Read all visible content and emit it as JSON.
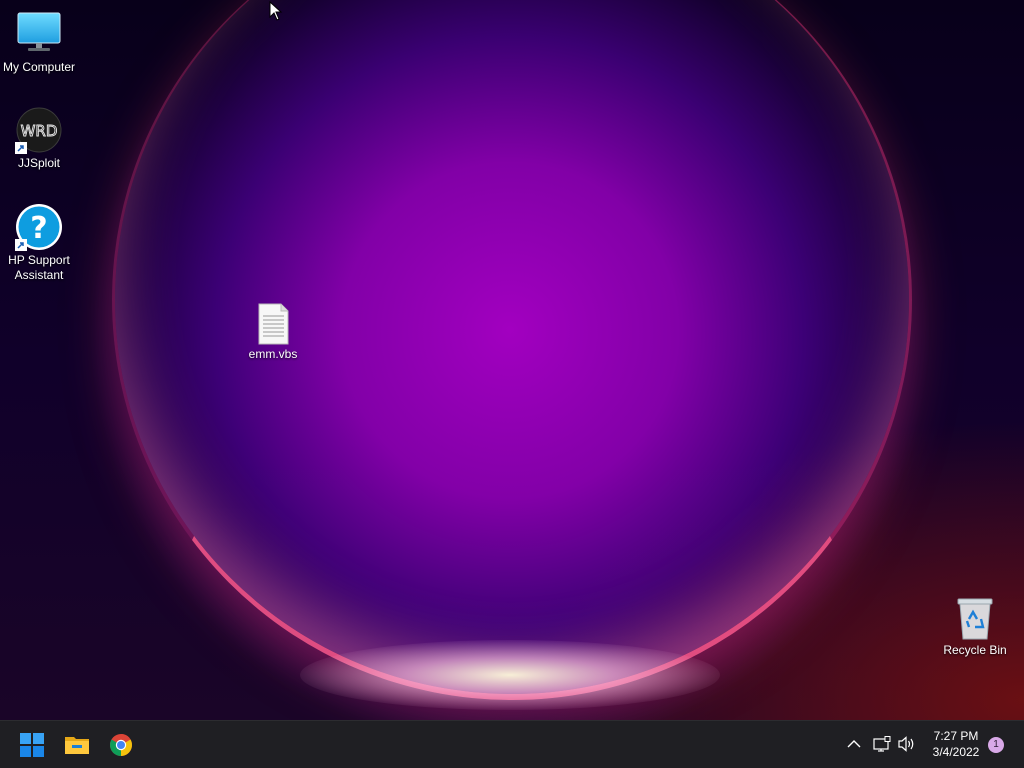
{
  "desktop": {
    "icons": [
      {
        "label": "My Computer",
        "icon": "monitor-icon"
      },
      {
        "label": "JJSploit",
        "icon": "jjsploit-icon",
        "shortcut": true
      },
      {
        "label": "HP Support\nAssistant",
        "icon": "question-mark-icon",
        "shortcut": true
      },
      {
        "label": "emm.vbs",
        "icon": "text-file-icon"
      },
      {
        "label": "Recycle Bin",
        "icon": "recycle-bin-icon"
      }
    ]
  },
  "taskbar": {
    "pinned": [
      {
        "name": "Start",
        "icon": "windows-logo-icon"
      },
      {
        "name": "File Explorer",
        "icon": "folder-icon"
      },
      {
        "name": "Google Chrome",
        "icon": "chrome-icon"
      }
    ],
    "tray": {
      "icons": [
        "chevron-up-icon",
        "network-icon",
        "speaker-icon"
      ]
    },
    "clock": {
      "time": "7:27 PM",
      "date": "3/4/2022"
    },
    "notification_count": "1"
  },
  "colors": {
    "taskbar_bg": "#1f1f23",
    "accent_blue": "#0a84ff",
    "badge": "#d9a9e8"
  }
}
